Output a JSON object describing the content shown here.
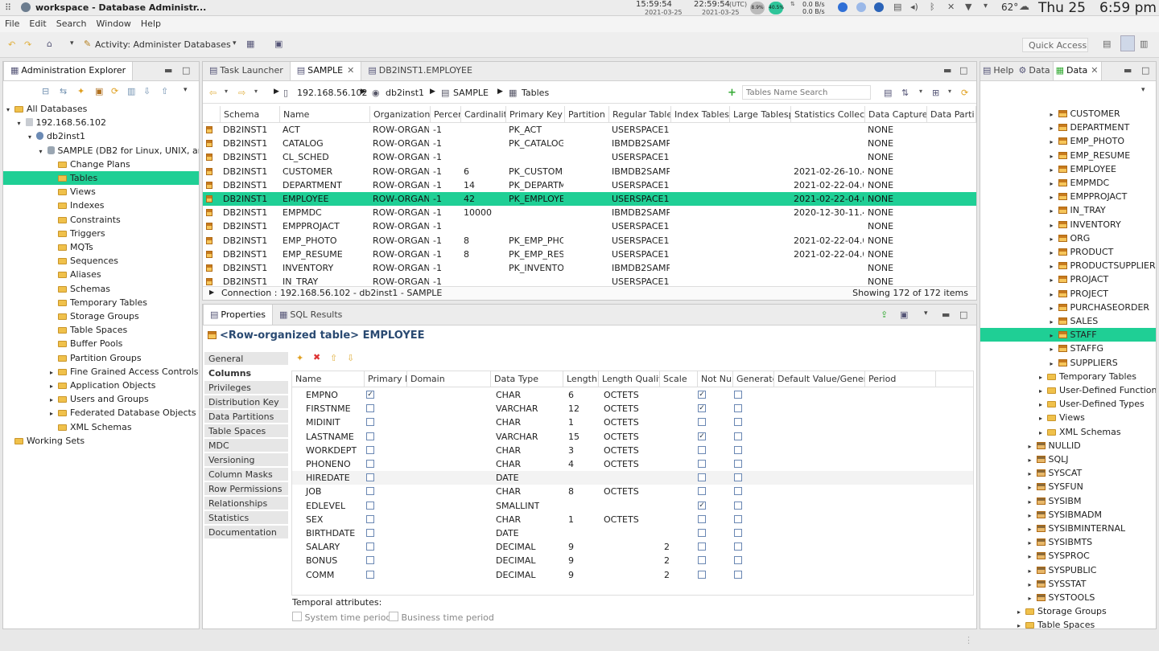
{
  "window": {
    "title": "workspace - Database Administr..."
  },
  "systray": {
    "time1": "15:59:54",
    "date1": "2021-03-25",
    "time2": "22:59:54",
    "date2": "2021-03-25",
    "tz": "(UTC)",
    "cpu": "8.9%",
    "mem": "40.5%",
    "net_up": "0.0 B/s",
    "net_down": "0.0 B/s",
    "temp": "62°",
    "day": "Thu 25",
    "clock": "6:59 pm"
  },
  "menu": [
    "File",
    "Edit",
    "Search",
    "Window",
    "Help"
  ],
  "toolbar": {
    "activity": "Activity: Administer Databases",
    "quick_access": "Quick Access"
  },
  "explorer": {
    "tab": "Administration Explorer",
    "nodes": [
      {
        "label": "All Databases",
        "indent": 0,
        "exp": "▾",
        "icon": "folder"
      },
      {
        "label": "192.168.56.102",
        "indent": 1,
        "exp": "▾",
        "icon": "server"
      },
      {
        "label": "db2inst1",
        "indent": 2,
        "exp": "▾",
        "icon": "instance"
      },
      {
        "label": "SAMPLE (DB2 for Linux, UNIX, and Windows)",
        "indent": 3,
        "exp": "▾",
        "icon": "db"
      },
      {
        "label": "Change Plans",
        "indent": 4,
        "exp": "",
        "icon": "folder"
      },
      {
        "label": "Tables",
        "indent": 4,
        "exp": "",
        "icon": "folder",
        "sel": true
      },
      {
        "label": "Views",
        "indent": 4,
        "exp": "",
        "icon": "folder"
      },
      {
        "label": "Indexes",
        "indent": 4,
        "exp": "",
        "icon": "folder"
      },
      {
        "label": "Constraints",
        "indent": 4,
        "exp": "",
        "icon": "folder"
      },
      {
        "label": "Triggers",
        "indent": 4,
        "exp": "",
        "icon": "folder"
      },
      {
        "label": "MQTs",
        "indent": 4,
        "exp": "",
        "icon": "folder"
      },
      {
        "label": "Sequences",
        "indent": 4,
        "exp": "",
        "icon": "folder"
      },
      {
        "label": "Aliases",
        "indent": 4,
        "exp": "",
        "icon": "folder"
      },
      {
        "label": "Schemas",
        "indent": 4,
        "exp": "",
        "icon": "folder"
      },
      {
        "label": "Temporary Tables",
        "indent": 4,
        "exp": "",
        "icon": "folder"
      },
      {
        "label": "Storage Groups",
        "indent": 4,
        "exp": "",
        "icon": "folder"
      },
      {
        "label": "Table Spaces",
        "indent": 4,
        "exp": "",
        "icon": "folder"
      },
      {
        "label": "Buffer Pools",
        "indent": 4,
        "exp": "",
        "icon": "folder"
      },
      {
        "label": "Partition Groups",
        "indent": 4,
        "exp": "",
        "icon": "folder"
      },
      {
        "label": "Fine Grained Access Controls",
        "indent": 4,
        "exp": "▸",
        "icon": "folder"
      },
      {
        "label": "Application Objects",
        "indent": 4,
        "exp": "▸",
        "icon": "folder"
      },
      {
        "label": "Users and Groups",
        "indent": 4,
        "exp": "▸",
        "icon": "folder"
      },
      {
        "label": "Federated Database Objects",
        "indent": 4,
        "exp": "▸",
        "icon": "folder"
      },
      {
        "label": "XML Schemas",
        "indent": 4,
        "exp": "",
        "icon": "folder"
      },
      {
        "label": "Working Sets",
        "indent": 0,
        "exp": "",
        "icon": "folder"
      }
    ]
  },
  "editor": {
    "tabs": [
      "Task Launcher",
      "SAMPLE",
      "DB2INST1.EMPLOYEE"
    ],
    "breadcrumb": [
      "192.168.56.102",
      "db2inst1",
      "SAMPLE",
      "Tables"
    ],
    "search_placeholder": "Tables Name Search",
    "columns": [
      "Schema",
      "Name",
      "Organization",
      "Percen",
      "Cardinality",
      "Primary Key",
      "Partition M",
      "Regular Table",
      "Index Tablesp",
      "Large Tablesp",
      "Statistics Collecte",
      "Data Capture",
      "Data Parti"
    ],
    "rows": [
      [
        "DB2INST1",
        "ACT",
        "ROW-ORGAN",
        "-1",
        "",
        "PK_ACT",
        "",
        "USERSPACE1",
        "",
        "",
        "",
        "NONE",
        ""
      ],
      [
        "DB2INST1",
        "CATALOG",
        "ROW-ORGAN",
        "-1",
        "",
        "PK_CATALOG",
        "",
        "IBMDB2SAMP",
        "",
        "",
        "",
        "NONE",
        ""
      ],
      [
        "DB2INST1",
        "CL_SCHED",
        "ROW-ORGAN",
        "-1",
        "",
        "",
        "",
        "USERSPACE1",
        "",
        "",
        "",
        "NONE",
        ""
      ],
      [
        "DB2INST1",
        "CUSTOMER",
        "ROW-ORGAN",
        "-1",
        "6",
        "PK_CUSTOME",
        "",
        "IBMDB2SAMP",
        "",
        "",
        "2021-02-26-10.42.4",
        "NONE",
        ""
      ],
      [
        "DB2INST1",
        "DEPARTMENT",
        "ROW-ORGAN",
        "-1",
        "14",
        "PK_DEPARTM",
        "",
        "USERSPACE1",
        "",
        "",
        "2021-02-22-04.06.",
        "NONE",
        ""
      ],
      [
        "DB2INST1",
        "EMPLOYEE",
        "ROW-ORGAN",
        "-1",
        "42",
        "PK_EMPLOYE",
        "",
        "USERSPACE1",
        "",
        "",
        "2021-02-22-04.06.",
        "NONE",
        ""
      ],
      [
        "DB2INST1",
        "EMPMDC",
        "ROW-ORGAN",
        "-1",
        "10000",
        "",
        "",
        "IBMDB2SAMP",
        "",
        "",
        "2020-12-30-11.42.2",
        "NONE",
        ""
      ],
      [
        "DB2INST1",
        "EMPPROJACT",
        "ROW-ORGAN",
        "-1",
        "",
        "",
        "",
        "USERSPACE1",
        "",
        "",
        "",
        "NONE",
        ""
      ],
      [
        "DB2INST1",
        "EMP_PHOTO",
        "ROW-ORGAN",
        "-1",
        "8",
        "PK_EMP_PHC",
        "",
        "USERSPACE1",
        "",
        "",
        "2021-02-22-04.06.",
        "NONE",
        ""
      ],
      [
        "DB2INST1",
        "EMP_RESUME",
        "ROW-ORGAN",
        "-1",
        "8",
        "PK_EMP_RESI",
        "",
        "USERSPACE1",
        "",
        "",
        "2021-02-22-04.06.",
        "NONE",
        ""
      ],
      [
        "DB2INST1",
        "INVENTORY",
        "ROW-ORGAN",
        "-1",
        "",
        "PK_INVENTOF",
        "",
        "IBMDB2SAMP",
        "",
        "",
        "",
        "NONE",
        ""
      ],
      [
        "DB2INST1",
        "IN_TRAY",
        "ROW-ORGAN",
        "-1",
        "",
        "",
        "",
        "USERSPACE1",
        "",
        "",
        "",
        "NONE",
        ""
      ]
    ],
    "selected_row": 5,
    "connection": "Connection : 192.168.56.102 - db2inst1 - SAMPLE",
    "showing": "Showing 172 of 172 items"
  },
  "properties": {
    "tabs": [
      "Properties",
      "SQL Results"
    ],
    "title": "<Row-organized table> EMPLOYEE",
    "side_tabs": [
      "General",
      "Columns",
      "Privileges",
      "Distribution Key",
      "Data Partitions",
      "Table Spaces",
      "MDC",
      "Versioning",
      "Column Masks",
      "Row Permissions",
      "Relationships",
      "Statistics",
      "Documentation"
    ],
    "active_side": 1,
    "col_headers": [
      "Name",
      "Primary K",
      "Domain",
      "Data Type",
      "Length",
      "Length Qualif",
      "Scale",
      "Not Nul",
      "Generated",
      "Default Value/Genera",
      "Period"
    ],
    "cols": [
      {
        "name": "EMPNO",
        "pk": true,
        "type": "CHAR",
        "len": "6",
        "qual": "OCTETS",
        "scale": "",
        "nn": true
      },
      {
        "name": "FIRSTNME",
        "pk": false,
        "type": "VARCHAR",
        "len": "12",
        "qual": "OCTETS",
        "scale": "",
        "nn": true
      },
      {
        "name": "MIDINIT",
        "pk": false,
        "type": "CHAR",
        "len": "1",
        "qual": "OCTETS",
        "scale": "",
        "nn": false
      },
      {
        "name": "LASTNAME",
        "pk": false,
        "type": "VARCHAR",
        "len": "15",
        "qual": "OCTETS",
        "scale": "",
        "nn": true
      },
      {
        "name": "WORKDEPT",
        "pk": false,
        "type": "CHAR",
        "len": "3",
        "qual": "OCTETS",
        "scale": "",
        "nn": false
      },
      {
        "name": "PHONENO",
        "pk": false,
        "type": "CHAR",
        "len": "4",
        "qual": "OCTETS",
        "scale": "",
        "nn": false
      },
      {
        "name": "HIREDATE",
        "pk": false,
        "type": "DATE",
        "len": "",
        "qual": "",
        "scale": "",
        "nn": false
      },
      {
        "name": "JOB",
        "pk": false,
        "type": "CHAR",
        "len": "8",
        "qual": "OCTETS",
        "scale": "",
        "nn": false
      },
      {
        "name": "EDLEVEL",
        "pk": false,
        "type": "SMALLINT",
        "len": "",
        "qual": "",
        "scale": "",
        "nn": true
      },
      {
        "name": "SEX",
        "pk": false,
        "type": "CHAR",
        "len": "1",
        "qual": "OCTETS",
        "scale": "",
        "nn": false
      },
      {
        "name": "BIRTHDATE",
        "pk": false,
        "type": "DATE",
        "len": "",
        "qual": "",
        "scale": "",
        "nn": false
      },
      {
        "name": "SALARY",
        "pk": false,
        "type": "DECIMAL",
        "len": "9",
        "qual": "",
        "scale": "2",
        "nn": false
      },
      {
        "name": "BONUS",
        "pk": false,
        "type": "DECIMAL",
        "len": "9",
        "qual": "",
        "scale": "2",
        "nn": false
      },
      {
        "name": "COMM",
        "pk": false,
        "type": "DECIMAL",
        "len": "9",
        "qual": "",
        "scale": "2",
        "nn": false
      }
    ],
    "temporal_label": "Temporal attributes:",
    "system_time": "System time period",
    "business_time": "Business time period"
  },
  "data_view": {
    "tabs": [
      "Help",
      "Data",
      "Data"
    ],
    "nodes": [
      {
        "label": "CUSTOMER",
        "indent": 3,
        "exp": "▸",
        "icon": "table"
      },
      {
        "label": "DEPARTMENT",
        "indent": 3,
        "exp": "▸",
        "icon": "table"
      },
      {
        "label": "EMP_PHOTO",
        "indent": 3,
        "exp": "▸",
        "icon": "table"
      },
      {
        "label": "EMP_RESUME",
        "indent": 3,
        "exp": "▸",
        "icon": "table"
      },
      {
        "label": "EMPLOYEE",
        "indent": 3,
        "exp": "▸",
        "icon": "table"
      },
      {
        "label": "EMPMDC",
        "indent": 3,
        "exp": "▸",
        "icon": "table"
      },
      {
        "label": "EMPPROJACT",
        "indent": 3,
        "exp": "▸",
        "icon": "table"
      },
      {
        "label": "IN_TRAY",
        "indent": 3,
        "exp": "▸",
        "icon": "table"
      },
      {
        "label": "INVENTORY",
        "indent": 3,
        "exp": "▸",
        "icon": "table"
      },
      {
        "label": "ORG",
        "indent": 3,
        "exp": "▸",
        "icon": "table"
      },
      {
        "label": "PRODUCT",
        "indent": 3,
        "exp": "▸",
        "icon": "table"
      },
      {
        "label": "PRODUCTSUPPLIER",
        "indent": 3,
        "exp": "▸",
        "icon": "table"
      },
      {
        "label": "PROJACT",
        "indent": 3,
        "exp": "▸",
        "icon": "table"
      },
      {
        "label": "PROJECT",
        "indent": 3,
        "exp": "▸",
        "icon": "table"
      },
      {
        "label": "PURCHASEORDER",
        "indent": 3,
        "exp": "▸",
        "icon": "table"
      },
      {
        "label": "SALES",
        "indent": 3,
        "exp": "▸",
        "icon": "table"
      },
      {
        "label": "STAFF",
        "indent": 3,
        "exp": "▸",
        "icon": "table",
        "sel": true
      },
      {
        "label": "STAFFG",
        "indent": 3,
        "exp": "▸",
        "icon": "table"
      },
      {
        "label": "SUPPLIERS",
        "indent": 3,
        "exp": "▸",
        "icon": "table"
      },
      {
        "label": "Temporary Tables",
        "indent": 2,
        "exp": "▸",
        "icon": "folder"
      },
      {
        "label": "User-Defined Functions",
        "indent": 2,
        "exp": "▸",
        "icon": "folder"
      },
      {
        "label": "User-Defined Types",
        "indent": 2,
        "exp": "▸",
        "icon": "folder"
      },
      {
        "label": "Views",
        "indent": 2,
        "exp": "▸",
        "icon": "folder"
      },
      {
        "label": "XML Schemas",
        "indent": 2,
        "exp": "▸",
        "icon": "folder"
      },
      {
        "label": "NULLID",
        "indent": 1,
        "exp": "▸",
        "icon": "schema"
      },
      {
        "label": "SQLJ",
        "indent": 1,
        "exp": "▸",
        "icon": "schema"
      },
      {
        "label": "SYSCAT",
        "indent": 1,
        "exp": "▸",
        "icon": "schema"
      },
      {
        "label": "SYSFUN",
        "indent": 1,
        "exp": "▸",
        "icon": "schema"
      },
      {
        "label": "SYSIBM",
        "indent": 1,
        "exp": "▸",
        "icon": "schema"
      },
      {
        "label": "SYSIBMADM",
        "indent": 1,
        "exp": "▸",
        "icon": "schema"
      },
      {
        "label": "SYSIBMINTERNAL",
        "indent": 1,
        "exp": "▸",
        "icon": "schema"
      },
      {
        "label": "SYSIBMTS",
        "indent": 1,
        "exp": "▸",
        "icon": "schema"
      },
      {
        "label": "SYSPROC",
        "indent": 1,
        "exp": "▸",
        "icon": "schema"
      },
      {
        "label": "SYSPUBLIC",
        "indent": 1,
        "exp": "▸",
        "icon": "schema"
      },
      {
        "label": "SYSSTAT",
        "indent": 1,
        "exp": "▸",
        "icon": "schema"
      },
      {
        "label": "SYSTOOLS",
        "indent": 1,
        "exp": "▸",
        "icon": "schema"
      },
      {
        "label": "Storage Groups",
        "indent": 0,
        "exp": "▸",
        "icon": "folder"
      },
      {
        "label": "Table Spaces",
        "indent": 0,
        "exp": "▸",
        "icon": "folder"
      }
    ]
  }
}
